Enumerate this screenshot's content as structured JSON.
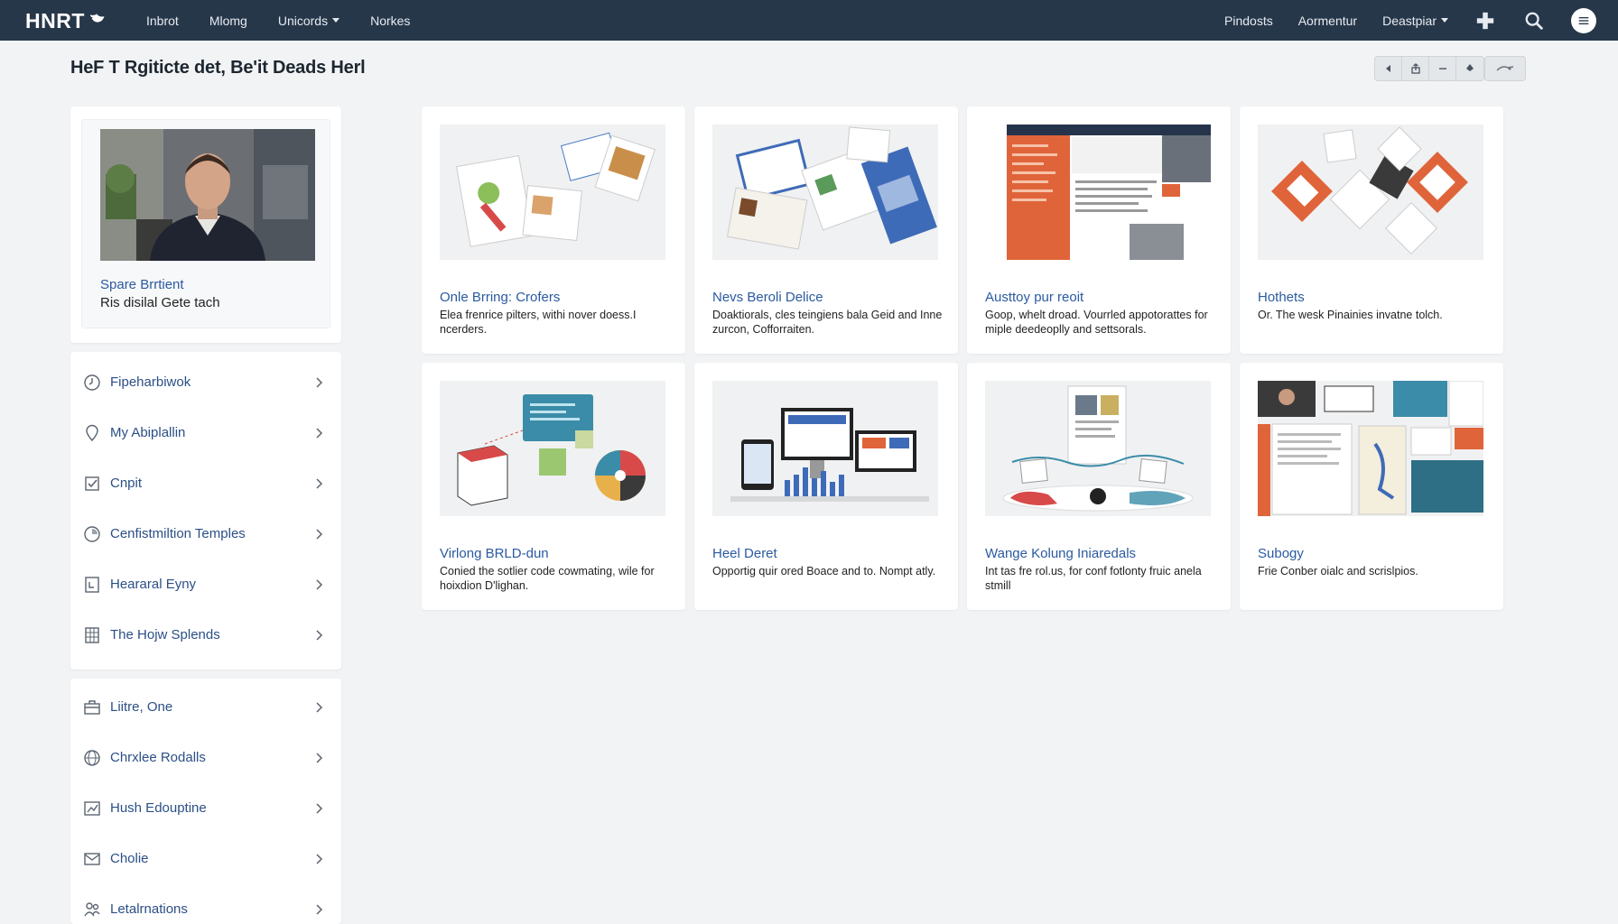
{
  "nav": {
    "logo": "HNRT",
    "left_links": [
      {
        "label": "Inbrot",
        "dropdown": false
      },
      {
        "label": "Mlomg",
        "dropdown": false
      },
      {
        "label": "Unicords",
        "dropdown": true
      },
      {
        "label": "Norkes",
        "dropdown": false
      }
    ],
    "right_links": [
      {
        "label": "Pindosts",
        "dropdown": false
      },
      {
        "label": "Aormentur",
        "dropdown": false
      },
      {
        "label": "Deastpiar",
        "dropdown": true
      }
    ],
    "icons": [
      "plus-icon",
      "search-icon",
      "hamburger-icon"
    ]
  },
  "page": {
    "title": "HeF T Rgiticte det, Be'it Deads Herl"
  },
  "toolbar": {
    "buttons": [
      "prev-icon",
      "share-icon",
      "minus-icon",
      "pin-icon"
    ],
    "extra": "view-icon"
  },
  "profile": {
    "name": "Spare Brrtient",
    "subtitle": "Ris disilal Gete tach"
  },
  "menu_groups": [
    {
      "items": [
        {
          "label": "Fipeharbiwok",
          "icon": "clock-icon"
        },
        {
          "label": "My Abiplallin",
          "icon": "location-pin-icon"
        },
        {
          "label": "Cnpit",
          "icon": "checkbox-icon"
        },
        {
          "label": "Cenfistmiltion Temples",
          "icon": "timer-icon"
        },
        {
          "label": "Heararal Eyny",
          "icon": "document-icon"
        },
        {
          "label": "The Hojw Splends",
          "icon": "calendar-grid-icon"
        }
      ]
    },
    {
      "items": [
        {
          "label": "Liitre, One",
          "icon": "briefcase-icon"
        },
        {
          "label": "Chrxlee Rodalls",
          "icon": "globe-icon"
        },
        {
          "label": "Hush Edouptine",
          "icon": "chart-icon"
        },
        {
          "label": "Cholie",
          "icon": "mail-icon"
        },
        {
          "label": "Letalrnations",
          "icon": "people-icon"
        }
      ]
    }
  ],
  "cards": [
    {
      "title": "Onle Brring: Crofers",
      "desc": "Elea frenrice pilters, withi nover doess.I ncerders.",
      "thumb": "thumb-documents-collage"
    },
    {
      "title": "Nevs Beroli Delice",
      "desc": "Doaktiorals, cles teingiens bala Geid and Inne zurcon, Cofforraiten.",
      "thumb": "thumb-brochure-spread"
    },
    {
      "title": "Austtoy pur reoit",
      "desc": "Goop, whelt droad. Vourrled appotorattes for miple deedeoplly and settsorals.",
      "thumb": "thumb-website-screenshot"
    },
    {
      "title": "Hothets",
      "desc": "Or. The wesk Pinainies invatne tolch.",
      "thumb": "thumb-diamond-photos"
    },
    {
      "title": "Virlong BRLD-dun",
      "desc": "Conied the sotlier code cowmating, wile for hoixdion D'lighan.",
      "thumb": "thumb-infographic"
    },
    {
      "title": "Heel Deret",
      "desc": "Opportig quir ored Boace and to. Nompt atly.",
      "thumb": "thumb-devices"
    },
    {
      "title": "Wange Kolung Iniaredals",
      "desc": "Int tas fre rol.us, for conf fotlonty fruic anela stmill",
      "thumb": "thumb-spectrum"
    },
    {
      "title": "Subogy",
      "desc": "Frie Conber oialc and scrislpios.",
      "thumb": "thumb-dashboard-collage"
    }
  ],
  "colors": {
    "nav_bg": "#27374a",
    "link_blue": "#2b5aa0",
    "page_bg": "#f1f3f4",
    "accent_orange": "#e0643a"
  }
}
